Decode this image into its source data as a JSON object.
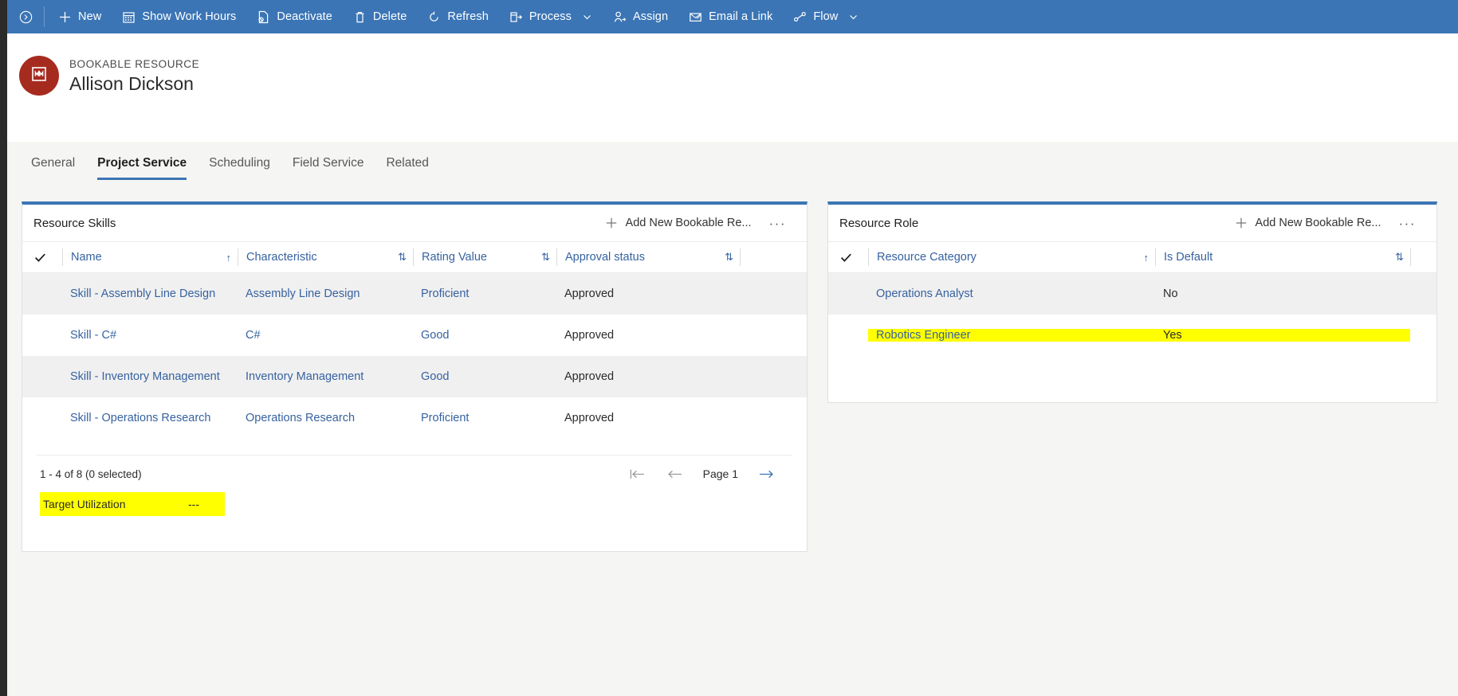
{
  "theme": {
    "command_bar_blue": "#3b75b5",
    "panel_accent_blue": "#3b75b5",
    "link_blue": "#3662a0",
    "avatar_red": "#a62b1f",
    "highlight_yellow": "#ffff00",
    "page_bg": "#f5f5f3",
    "rail_dark": "#2b2b2b"
  },
  "command_bar": {
    "entity_button_icon": "circle-chevron-right-icon",
    "items": [
      {
        "label": "New",
        "icon": "plus-icon",
        "caret": false
      },
      {
        "label": "Show Work Hours",
        "icon": "calendar-icon",
        "caret": false
      },
      {
        "label": "Deactivate",
        "icon": "deactivate-icon",
        "caret": false
      },
      {
        "label": "Delete",
        "icon": "trash-icon",
        "caret": false
      },
      {
        "label": "Refresh",
        "icon": "refresh-icon",
        "caret": false
      },
      {
        "label": "Process",
        "icon": "process-icon",
        "caret": true
      },
      {
        "label": "Assign",
        "icon": "assign-user-icon",
        "caret": false
      },
      {
        "label": "Email a Link",
        "icon": "email-link-icon",
        "caret": false
      },
      {
        "label": "Flow",
        "icon": "flow-icon",
        "caret": true
      }
    ]
  },
  "record_header": {
    "avatar_icon": "bookable-resource-icon",
    "entity_type": "BOOKABLE RESOURCE",
    "record_name": "Allison Dickson"
  },
  "tabs": [
    {
      "label": "General",
      "active": false
    },
    {
      "label": "Project Service",
      "active": true
    },
    {
      "label": "Scheduling",
      "active": false
    },
    {
      "label": "Field Service",
      "active": false
    },
    {
      "label": "Related",
      "active": false
    }
  ],
  "skills_panel": {
    "title": "Resource Skills",
    "add_label": "Add New Bookable Re...",
    "add_icon": "plus-icon",
    "more_icon": "ellipsis-icon",
    "more_label": "···",
    "select_all_icon": "checkmark-icon",
    "columns": [
      {
        "label": "Name",
        "sort": "↑",
        "sort_icon": "sort-ascending-icon"
      },
      {
        "label": "Characteristic",
        "sort": "⇅",
        "sort_icon": "sort-unsorted-icon"
      },
      {
        "label": "Rating Value",
        "sort": "⇅",
        "sort_icon": "sort-unsorted-icon"
      },
      {
        "label": "Approval status",
        "sort": "⇅",
        "sort_icon": "sort-unsorted-icon"
      }
    ],
    "rows": [
      {
        "name": "Skill - Assembly Line Design",
        "characteristic": "Assembly Line Design",
        "rating": "Proficient",
        "approval": "Approved"
      },
      {
        "name": "Skill - C#",
        "characteristic": "C#",
        "rating": "Good",
        "approval": "Approved"
      },
      {
        "name": "Skill - Inventory Management",
        "characteristic": "Inventory Management",
        "rating": "Good",
        "approval": "Approved"
      },
      {
        "name": "Skill - Operations Research",
        "characteristic": "Operations Research",
        "rating": "Proficient",
        "approval": "Approved"
      }
    ],
    "footer": {
      "count_text": "1 - 4 of 8 (0 selected)",
      "first_page_icon": "first-page-icon",
      "previous_page_icon": "previous-page-icon",
      "page_label": "Page 1",
      "next_page_icon": "next-page-icon"
    },
    "target_utilization": {
      "label": "Target Utilization",
      "value": "---",
      "highlighted": true
    }
  },
  "role_panel": {
    "title": "Resource Role",
    "add_label": "Add New Bookable Re...",
    "add_icon": "plus-icon",
    "more_icon": "ellipsis-icon",
    "more_label": "···",
    "select_all_icon": "checkmark-icon",
    "columns": [
      {
        "label": "Resource Category",
        "sort": "↑",
        "sort_icon": "sort-ascending-icon"
      },
      {
        "label": "Is Default",
        "sort": "⇅",
        "sort_icon": "sort-unsorted-icon"
      }
    ],
    "rows": [
      {
        "category": "Operations Analyst",
        "is_default": "No",
        "highlighted": false
      },
      {
        "category": "Robotics Engineer",
        "is_default": "Yes",
        "highlighted": true
      }
    ]
  }
}
